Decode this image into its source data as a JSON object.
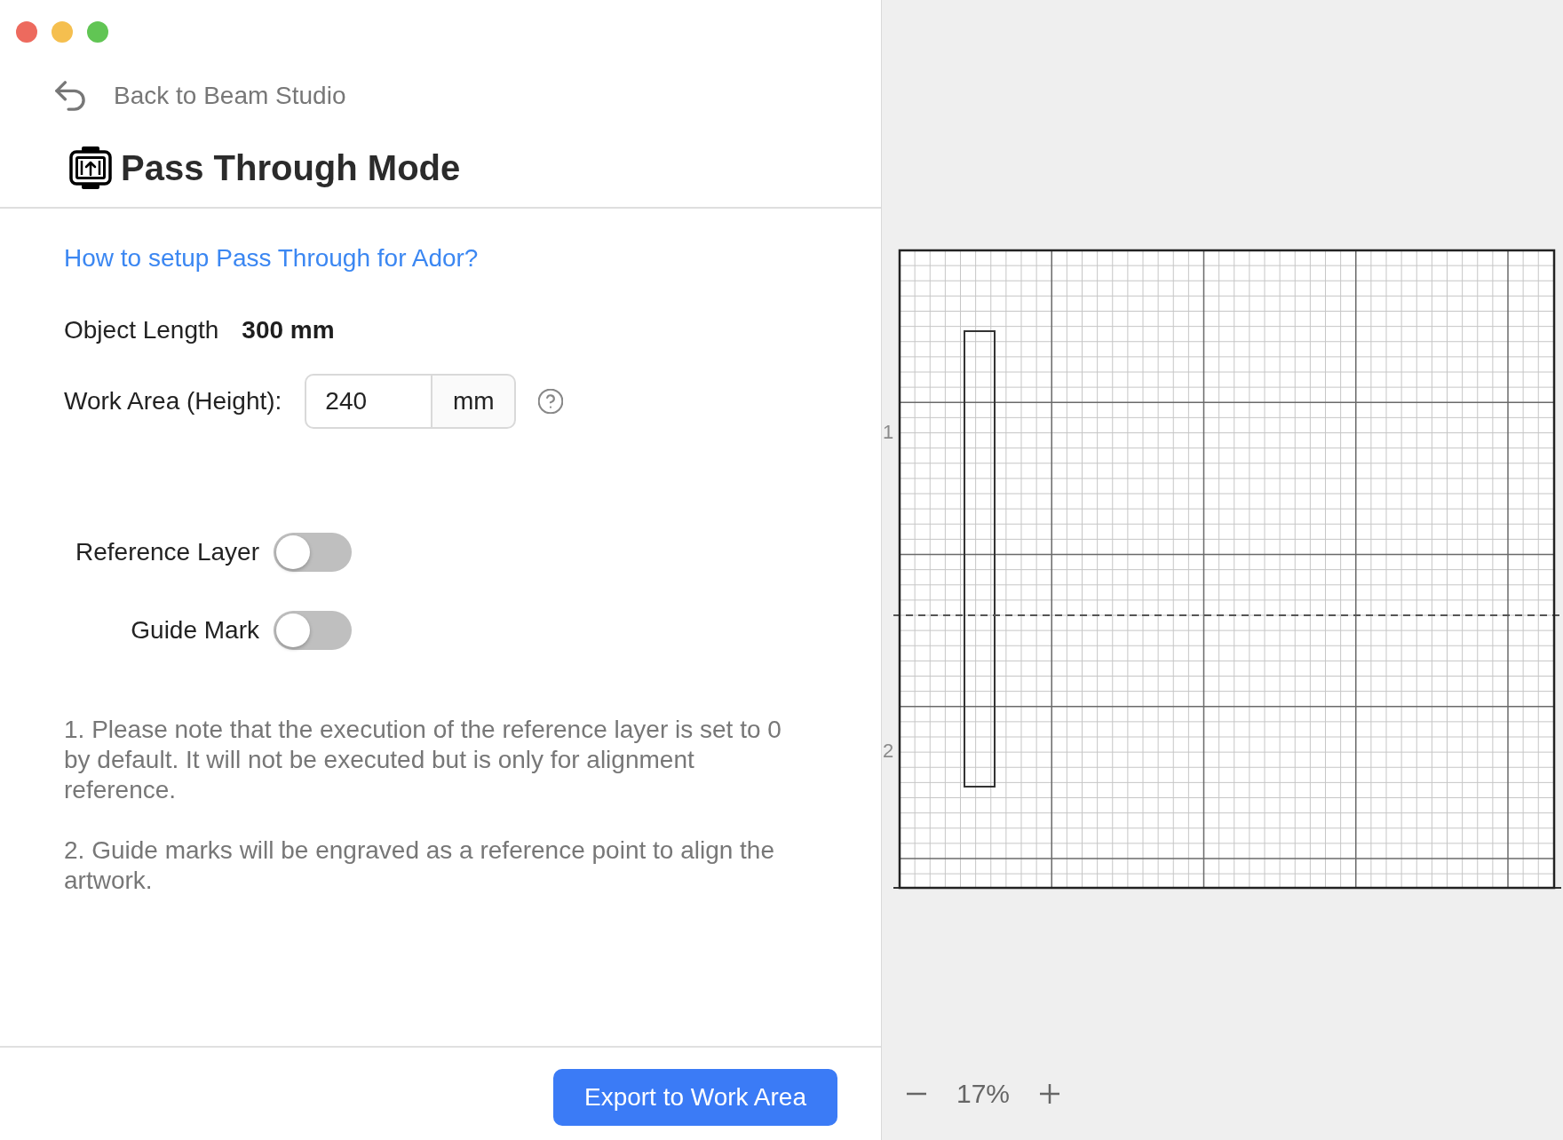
{
  "window": {
    "controls": [
      {
        "color": "#ed6a5e"
      },
      {
        "color": "#f5bf4f"
      },
      {
        "color": "#61c554"
      }
    ]
  },
  "header": {
    "back_link": "Back to Beam Studio",
    "title": "Pass Through Mode"
  },
  "form": {
    "help_link": "How to setup Pass Through for Ador?",
    "object_length": {
      "label": "Object Length",
      "value": "300 mm"
    },
    "work_area": {
      "label": "Work Area (Height):",
      "value": "240",
      "unit": "mm"
    },
    "toggles": [
      {
        "label": "Reference Layer",
        "on": false
      },
      {
        "label": "Guide Mark",
        "on": false
      }
    ],
    "notes": [
      "1. Please note that the execution of the reference layer is set to 0 by default. It will not be executed but is only for alignment reference.",
      "2. Guide marks will be engraved as a reference point to align the artwork."
    ]
  },
  "footer": {
    "export_button": "Export to Work Area"
  },
  "preview": {
    "ruler_labels": [
      "1",
      "2"
    ],
    "zoom": "17%"
  }
}
